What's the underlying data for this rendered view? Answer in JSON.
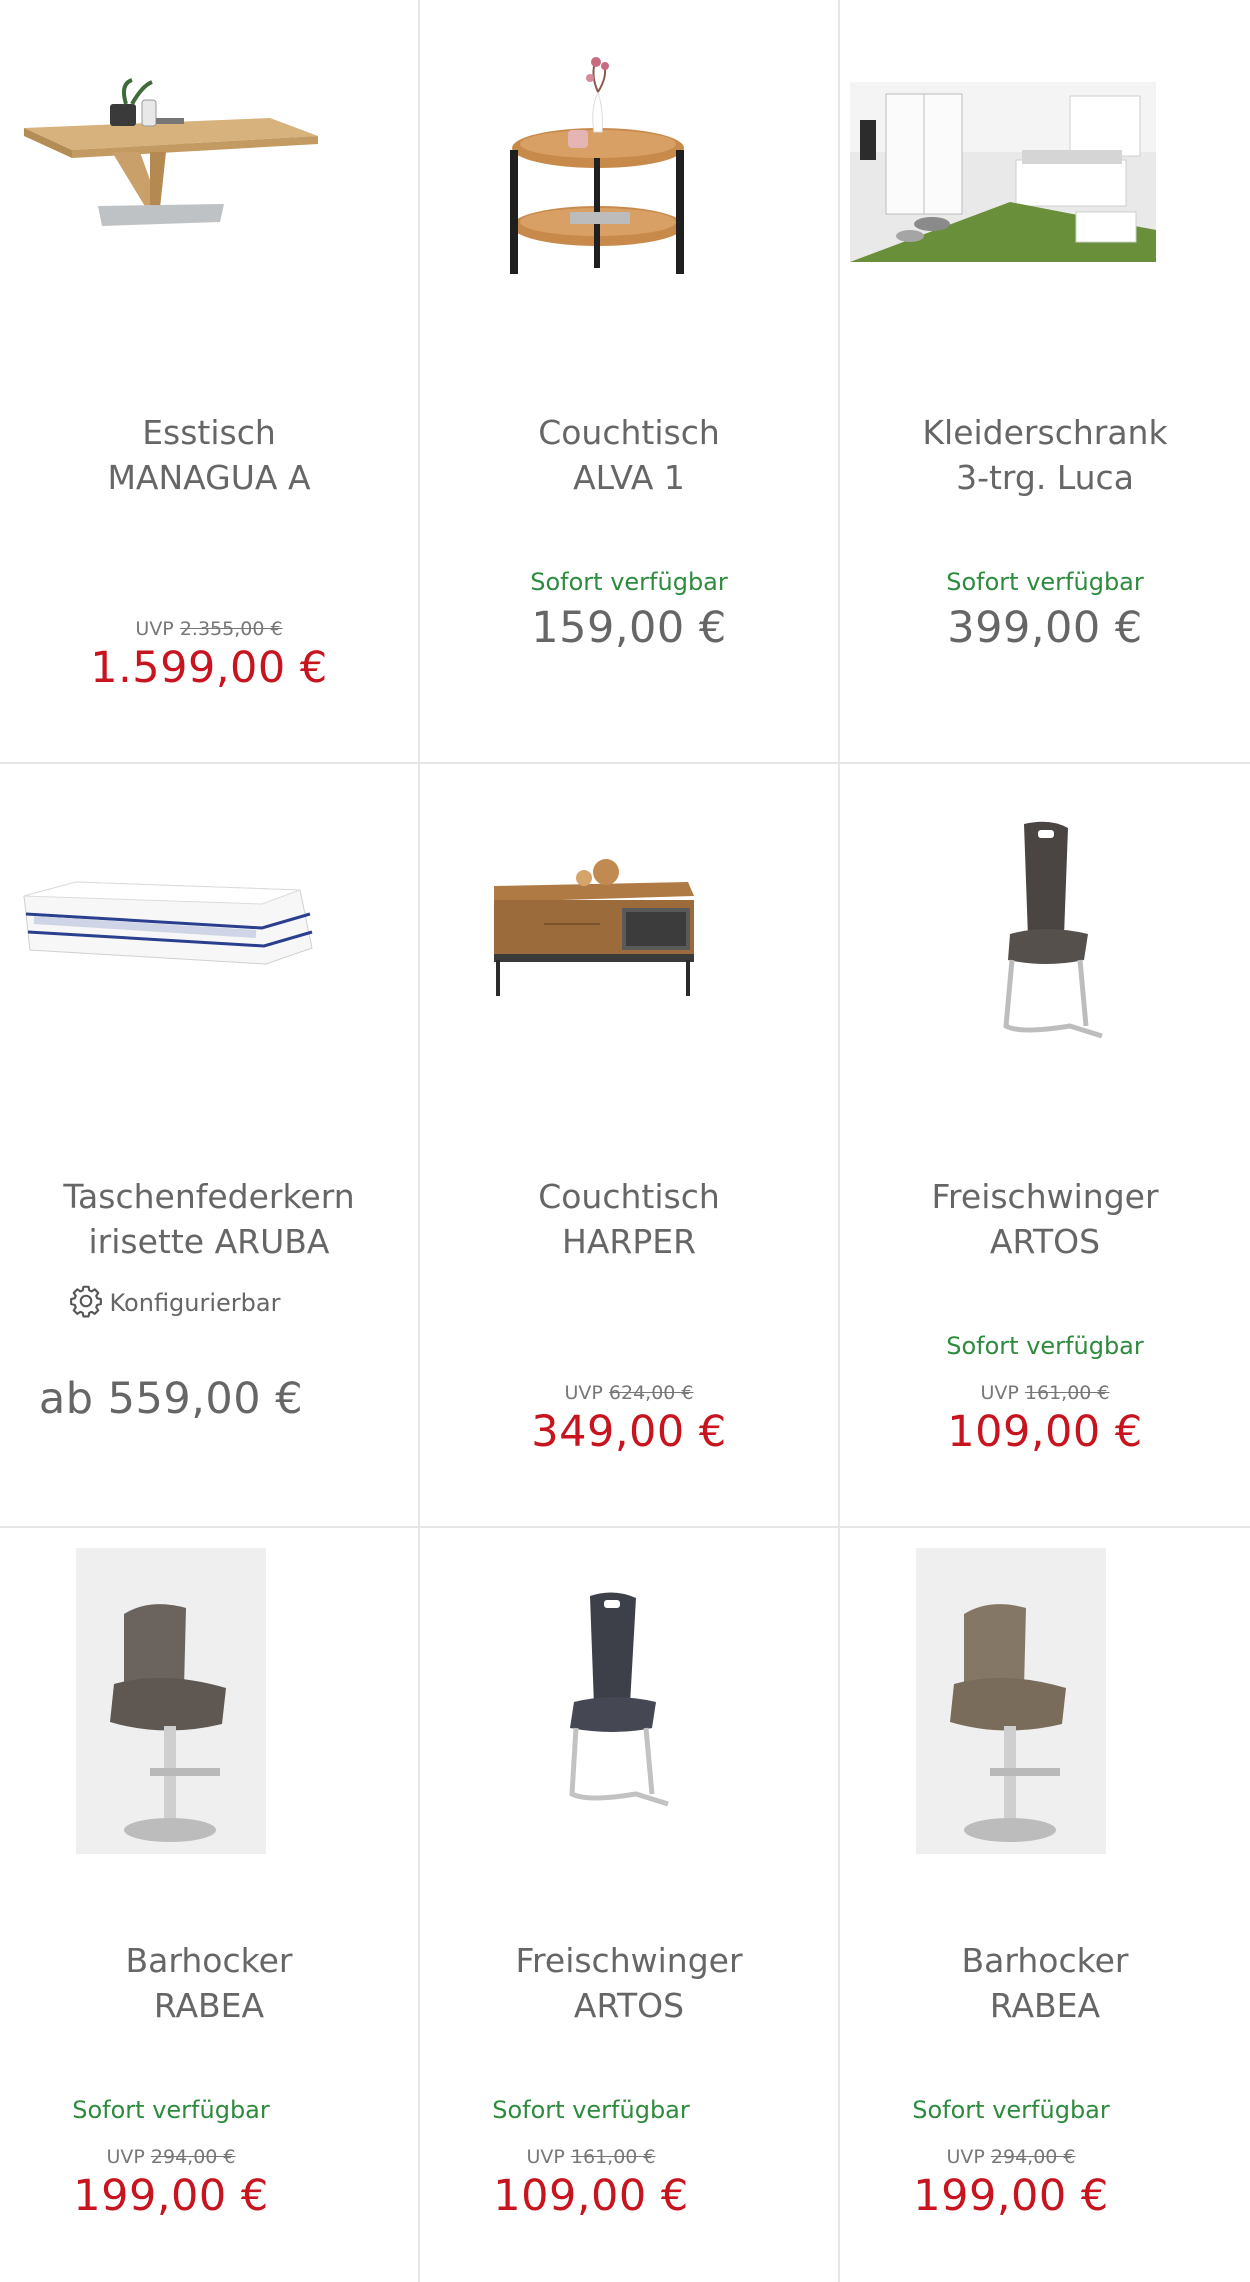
{
  "products": [
    {
      "title": [
        "Esstisch",
        "MANAGUA A"
      ],
      "availability": "",
      "uvp_label": "UVP",
      "uvp_price": "2.355,00 €",
      "price": "1.599,00 €",
      "image": "dining-table-image"
    },
    {
      "title": [
        "Couchtisch",
        "ALVA 1"
      ],
      "availability": "Sofort verfügbar",
      "uvp_label": "",
      "uvp_price": "",
      "price": "159,00 €",
      "image": "round-side-table-image"
    },
    {
      "title": [
        "Kleiderschrank",
        "3-trg. Luca"
      ],
      "availability": "Sofort verfügbar",
      "uvp_label": "",
      "uvp_price": "",
      "price": "399,00 €",
      "image": "bedroom-wardrobe-image"
    },
    {
      "title": [
        "Taschenfederkern",
        "irisette ARUBA"
      ],
      "configurable_label": "Konfigurierbar",
      "availability": "",
      "uvp_label": "",
      "uvp_price": "",
      "price": "ab 559,00 €",
      "image": "mattress-image"
    },
    {
      "title": [
        "Couchtisch",
        "HARPER"
      ],
      "availability": "",
      "uvp_label": "UVP",
      "uvp_price": "624,00 €",
      "price": "349,00 €",
      "image": "coffee-table-image"
    },
    {
      "title": [
        "Freischwinger",
        "ARTOS"
      ],
      "availability": "Sofort verfügbar",
      "uvp_label": "UVP",
      "uvp_price": "161,00 €",
      "price": "109,00 €",
      "image": "cantilever-chair-brown-image"
    },
    {
      "title": [
        "Barhocker",
        "RABEA"
      ],
      "availability": "Sofort verfügbar",
      "uvp_label": "UVP",
      "uvp_price": "294,00 €",
      "price": "199,00 €",
      "image": "bar-stool-dark-image"
    },
    {
      "title": [
        "Freischwinger",
        "ARTOS"
      ],
      "availability": "Sofort verfügbar",
      "uvp_label": "UVP",
      "uvp_price": "161,00 €",
      "price": "109,00 €",
      "image": "cantilever-chair-anthracite-image"
    },
    {
      "title": [
        "Barhocker",
        "RABEA"
      ],
      "availability": "Sofort verfügbar",
      "uvp_label": "UVP",
      "uvp_price": "294,00 €",
      "price": "199,00 €",
      "image": "bar-stool-taupe-image"
    }
  ],
  "colors": {
    "sale_price": "#c8141e",
    "availability": "#2e8b3e",
    "text": "#666666",
    "divider": "#e6e6e6"
  }
}
